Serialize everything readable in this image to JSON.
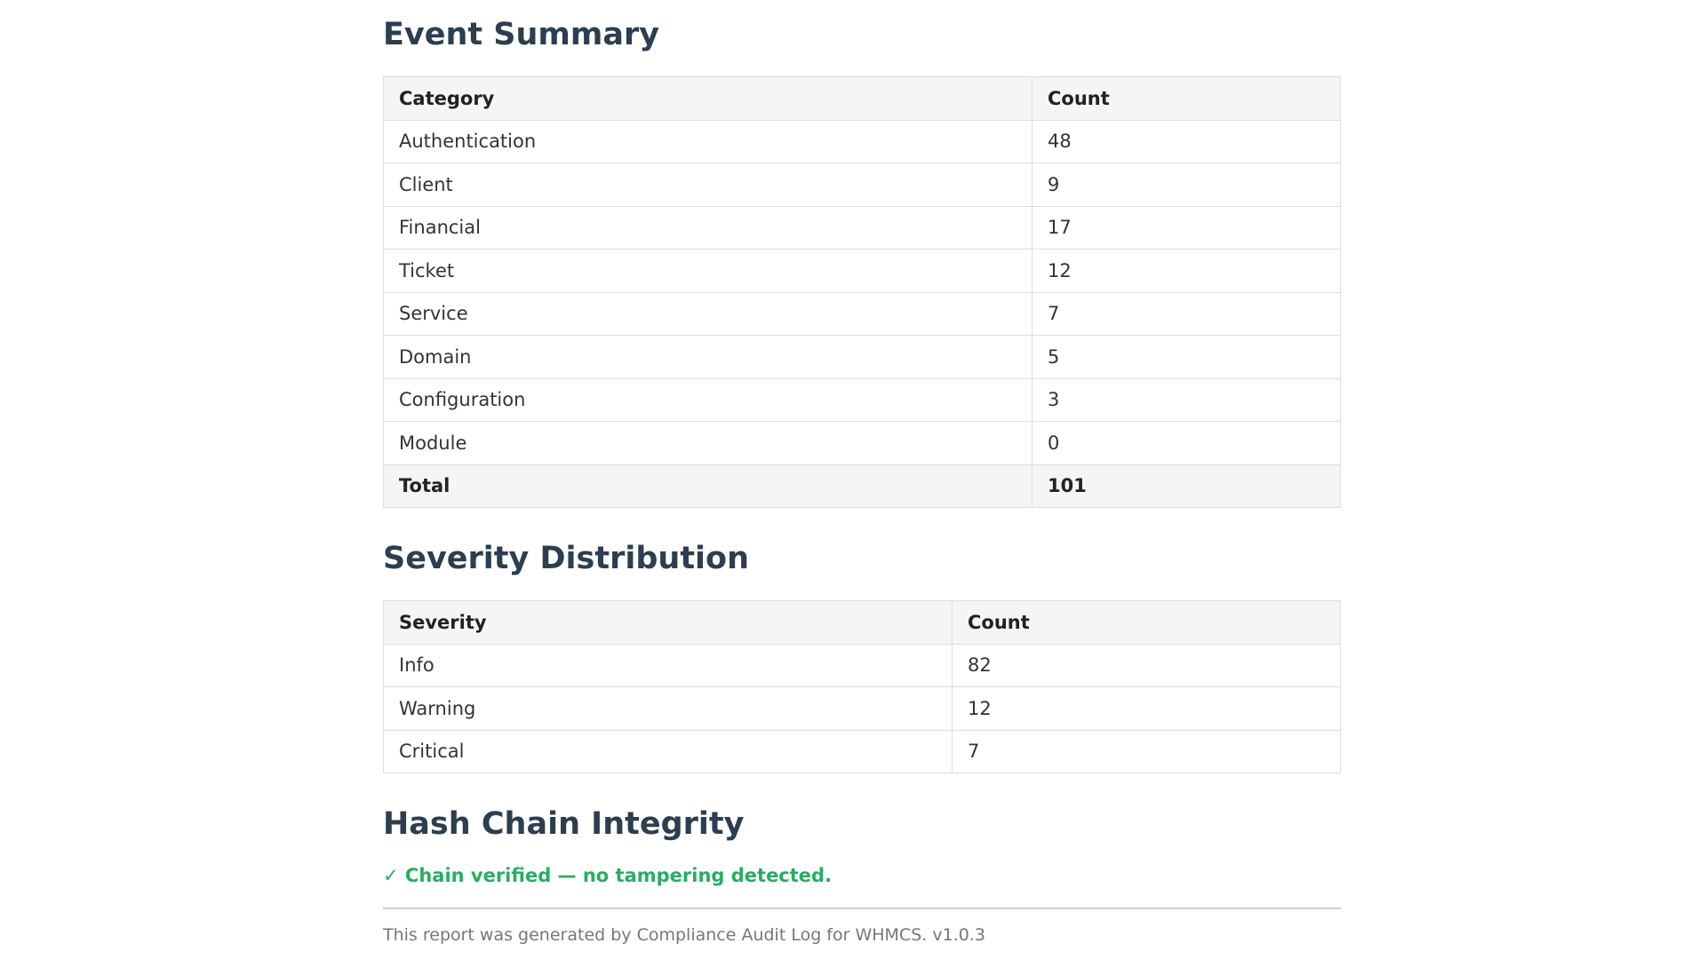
{
  "event_summary": {
    "title": "Event Summary",
    "headers": [
      "Category",
      "Count"
    ],
    "rows": [
      {
        "category": "Authentication",
        "count": "48"
      },
      {
        "category": "Client",
        "count": "9"
      },
      {
        "category": "Financial",
        "count": "17"
      },
      {
        "category": "Ticket",
        "count": "12"
      },
      {
        "category": "Service",
        "count": "7"
      },
      {
        "category": "Domain",
        "count": "5"
      },
      {
        "category": "Configuration",
        "count": "3"
      },
      {
        "category": "Module",
        "count": "0"
      }
    ],
    "total": {
      "label": "Total",
      "count": "101"
    }
  },
  "severity_distribution": {
    "title": "Severity Distribution",
    "headers": [
      "Severity",
      "Count"
    ],
    "rows": [
      {
        "severity": "Info",
        "count": "82"
      },
      {
        "severity": "Warning",
        "count": "12"
      },
      {
        "severity": "Critical",
        "count": "7"
      }
    ]
  },
  "hash_chain": {
    "title": "Hash Chain Integrity",
    "status": "✓ Chain verified — no tampering detected.",
    "status_color": "#27ae60"
  },
  "footer": {
    "text": "This report was generated by Compliance Audit Log for WHMCS. v1.0.3"
  }
}
